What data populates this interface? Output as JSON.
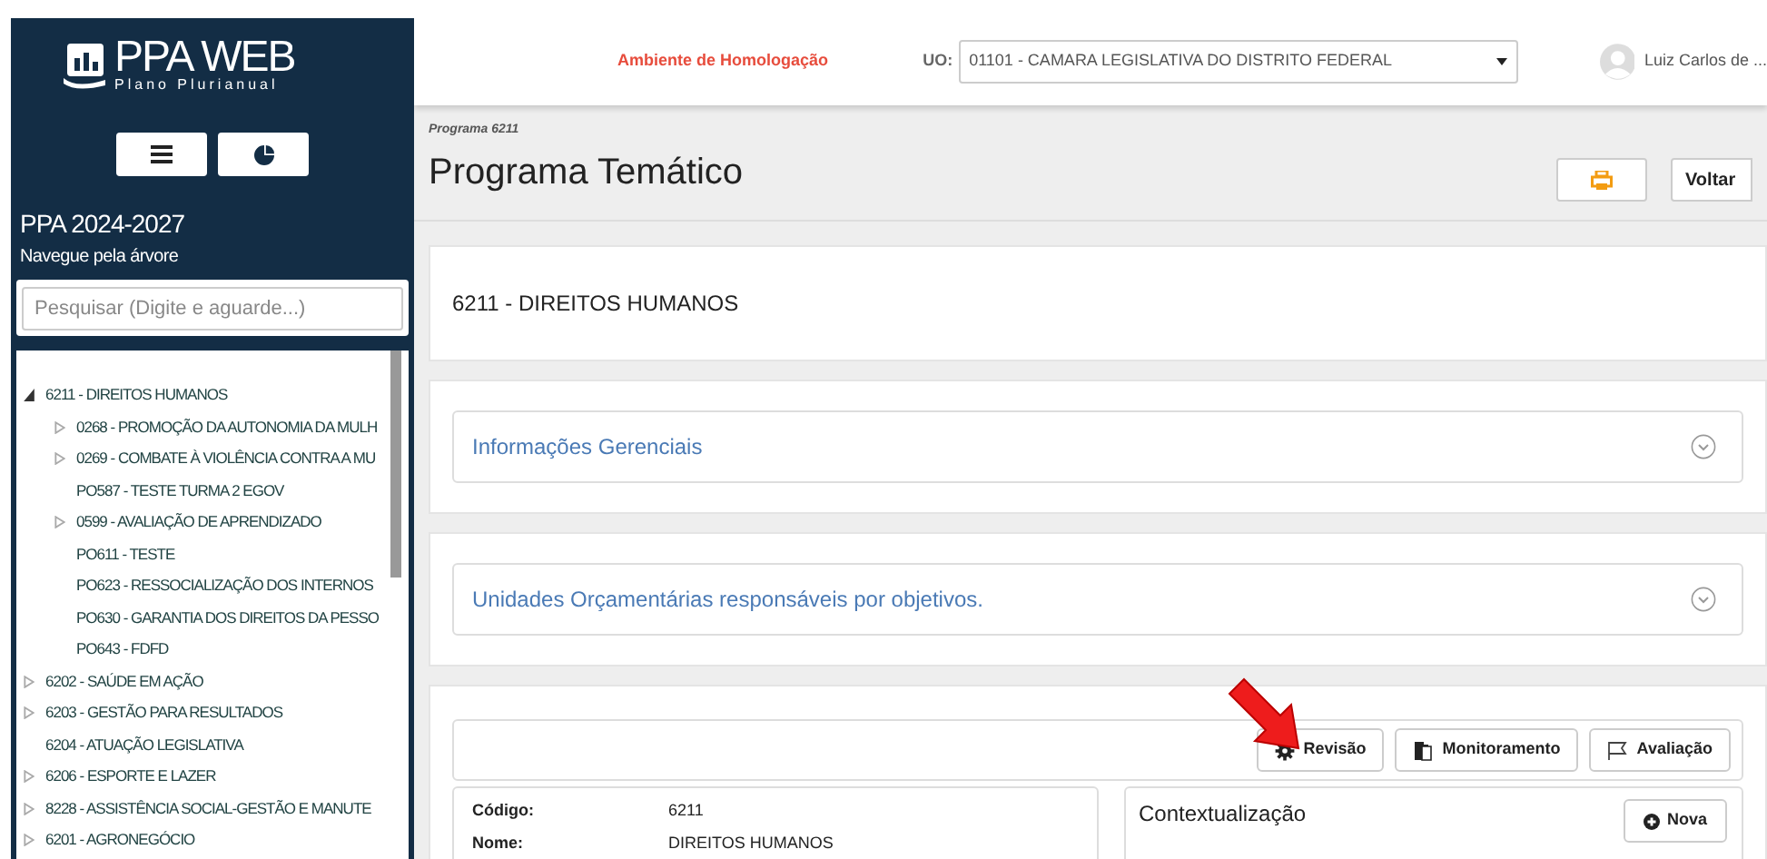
{
  "sidebar": {
    "logo": {
      "title": "PPA WEB",
      "subtitle": "Plano Plurianual"
    },
    "ppa_title": "PPA 2024-2027",
    "ppa_subtitle": "Navegue pela árvore",
    "search": {
      "placeholder": "Pesquisar (Digite e aguarde...)"
    },
    "tree": [
      {
        "label": "6211 - DIREITOS HUMANOS",
        "kind": "branch",
        "expanded": true,
        "children": [
          {
            "label": "0268 - PROMOÇÃO DA AUTONOMIA DA MULH",
            "kind": "branch",
            "expanded": false
          },
          {
            "label": "0269 - COMBATE À VIOLÊNCIA CONTRA A MU",
            "kind": "branch",
            "expanded": false
          },
          {
            "label": "PO587 - TESTE TURMA 2 EGOV",
            "kind": "leaf"
          },
          {
            "label": "0599 - AVALIAÇÃO DE APRENDIZADO",
            "kind": "branch",
            "expanded": false
          },
          {
            "label": "PO611 - TESTE",
            "kind": "leaf"
          },
          {
            "label": "PO623 - RESSOCIALIZAÇÃO DOS INTERNOS",
            "kind": "leaf"
          },
          {
            "label": "PO630 - GARANTIA DOS DIREITOS DA PESSO",
            "kind": "leaf"
          },
          {
            "label": "PO643 - FDFD",
            "kind": "leaf"
          }
        ]
      },
      {
        "label": "6202 - SAÚDE EM AÇÃO",
        "kind": "branch",
        "expanded": false
      },
      {
        "label": "6203 - GESTÃO PARA RESULTADOS",
        "kind": "branch",
        "expanded": false
      },
      {
        "label": "6204 - ATUAÇÃO LEGISLATIVA",
        "kind": "leaf"
      },
      {
        "label": "6206 - ESPORTE E LAZER",
        "kind": "branch",
        "expanded": false
      },
      {
        "label": "8228 - ASSISTÊNCIA SOCIAL-GESTÃO E MANUTE",
        "kind": "branch",
        "expanded": false
      },
      {
        "label": "6201 - AGRONEGÓCIO",
        "kind": "branch",
        "expanded": false
      }
    ]
  },
  "header": {
    "environment": "Ambiente de Homologação",
    "uo_label": "UO:",
    "uo_value": "01101 - CAMARA LEGISLATIVA DO DISTRITO FEDERAL",
    "user": "Luiz Carlos de ..."
  },
  "page": {
    "breadcrumb": "Programa 6211",
    "title": "Programa Temático",
    "back_button": "Voltar"
  },
  "program_name": "6211 - DIREITOS HUMANOS",
  "sections": [
    {
      "title": "Informações Gerenciais",
      "expanded": false
    },
    {
      "title": "Unidades Orçamentárias responsáveis por objetivos.",
      "expanded": false
    }
  ],
  "actions": [
    {
      "label": "Revisão",
      "kind": "gear"
    },
    {
      "label": "Monitoramento",
      "kind": "document"
    },
    {
      "label": "Avaliação",
      "kind": "flag"
    }
  ],
  "details": [
    {
      "label": "Código:",
      "value": "6211"
    },
    {
      "label": "Nome:",
      "value": "DIREITOS HUMANOS"
    }
  ],
  "context": {
    "title": "Contextualização",
    "new_button": "Nova"
  }
}
